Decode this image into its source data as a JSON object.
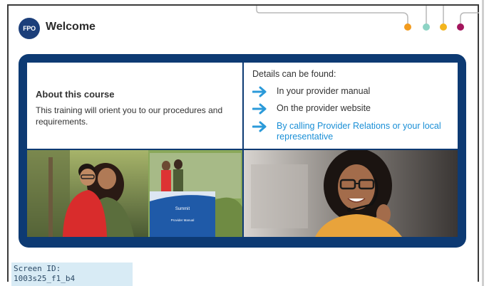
{
  "header": {
    "logo_text": "FPO",
    "title": "Welcome"
  },
  "progress_dots": {
    "colors": [
      "#f29b1e",
      "#8dd3c4",
      "#f3b51e",
      "#a3155c"
    ]
  },
  "about": {
    "heading": "About this course",
    "text": "This training will orient you to our procedures and requirements."
  },
  "details": {
    "heading": "Details can be found:",
    "items": [
      {
        "label": "In your provider manual",
        "is_link": false
      },
      {
        "label": "On the provider website",
        "is_link": false
      },
      {
        "label": "By calling Provider Relations or your local representative",
        "is_link": true
      }
    ]
  },
  "manual": {
    "brand": "Summit",
    "title": "Provider Manual"
  },
  "footer": {
    "screen_id_label": "Screen ID:",
    "screen_id_value": "1003s25_f1_b4"
  },
  "colors": {
    "panel": "#0d3a73",
    "arrow": "#2b9ad9",
    "link": "#1a8fd6"
  }
}
